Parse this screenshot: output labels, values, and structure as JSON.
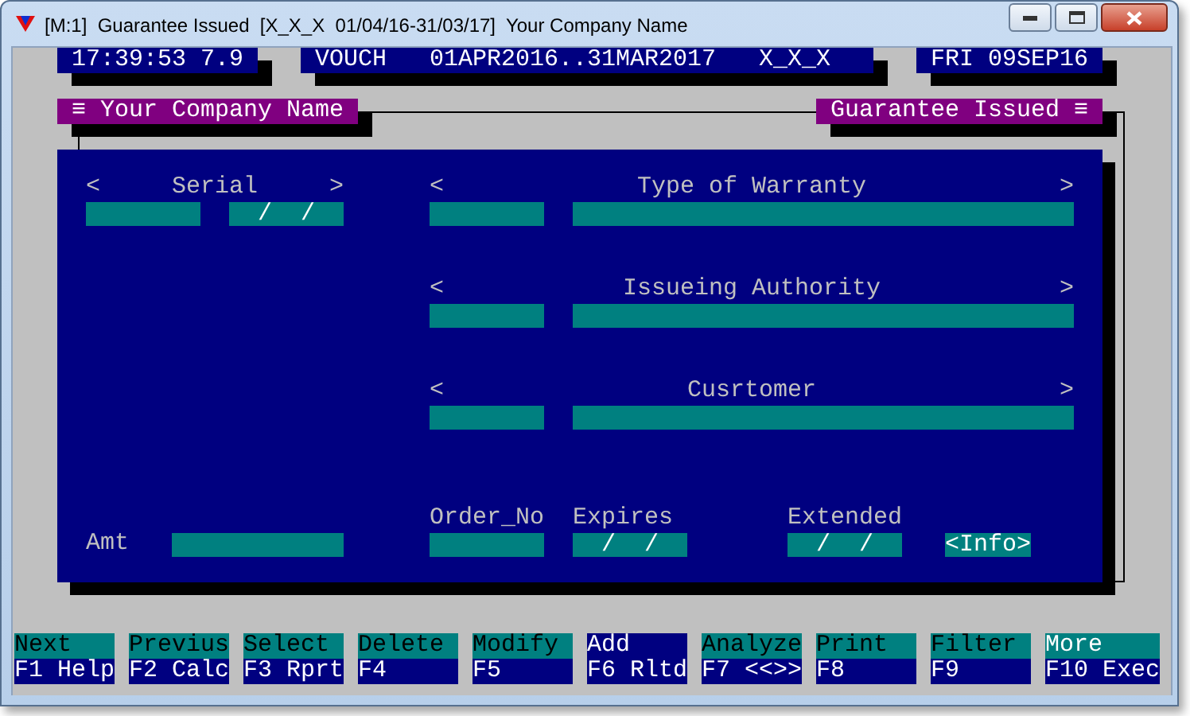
{
  "window": {
    "title": "[M:1]  Guarantee Issued  [X_X_X  01/04/16-31/03/17]  Your Company Name"
  },
  "status": {
    "time": "17:39:53 7.9",
    "voucher": [
      "VOUCH",
      "01APR2016..31MAR2017",
      "X_X_X"
    ],
    "date": "FRI 09SEP16"
  },
  "panel_titles": {
    "left": "≡ Your Company Name",
    "right": "Guarantee Issued ≡"
  },
  "serial": {
    "prev": "<",
    "label": "Serial",
    "next": ">",
    "date_value": "/  /"
  },
  "lookups": [
    {
      "prev": "<",
      "label": "Type of Warranty",
      "next": ">"
    },
    {
      "prev": "<",
      "label": "Issueing Authority",
      "next": ">"
    },
    {
      "prev": "<",
      "label": "Cusrtomer",
      "next": ">"
    }
  ],
  "footer": {
    "amt_label": "Amt",
    "order_label": "Order_No",
    "expires_label": "Expires",
    "expires_value": "/  /",
    "extended_label": "Extended",
    "extended_value": "/  /",
    "info_button": "<Info>"
  },
  "keys": [
    {
      "top": "Next",
      "bottom": "F1 Help",
      "selected": false,
      "highlighted": false
    },
    {
      "top": "Previus",
      "bottom": "F2 Calc",
      "selected": false,
      "highlighted": false
    },
    {
      "top": "Select",
      "bottom": "F3 Rprt",
      "selected": false,
      "highlighted": false
    },
    {
      "top": "Delete",
      "bottom": "F4",
      "selected": false,
      "highlighted": false
    },
    {
      "top": "Modify",
      "bottom": "F5",
      "selected": false,
      "highlighted": false
    },
    {
      "top": "Add",
      "bottom": "F6 Rltd",
      "selected": true,
      "highlighted": false
    },
    {
      "top": "Analyze",
      "bottom": "F7 <<>>",
      "selected": false,
      "highlighted": false
    },
    {
      "top": "Print",
      "bottom": "F8",
      "selected": false,
      "highlighted": false
    },
    {
      "top": "Filter",
      "bottom": "F9",
      "selected": false,
      "highlighted": false
    },
    {
      "top": "More",
      "bottom": "F10 Exec",
      "selected": false,
      "highlighted": true
    }
  ]
}
